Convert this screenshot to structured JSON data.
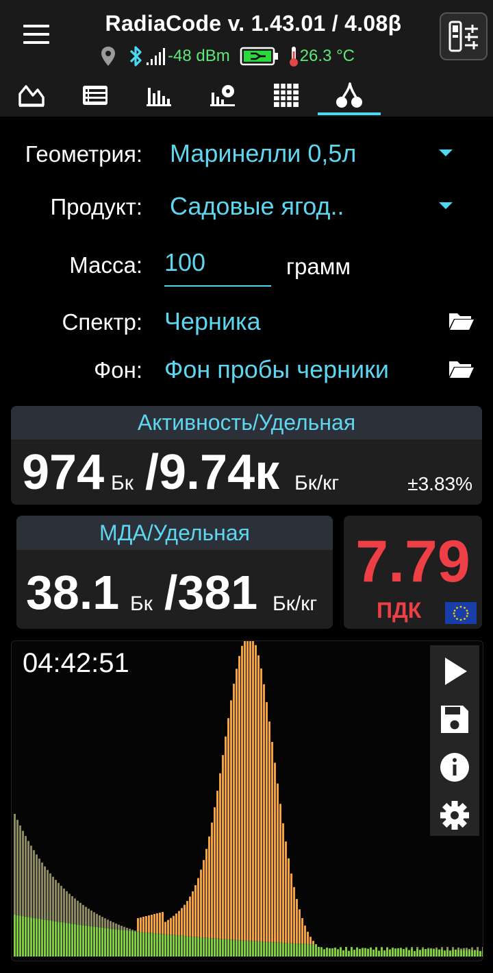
{
  "header": {
    "title": "RadiaCode v. 1.43.01 / 4.08β",
    "signal": "-48 dBm",
    "temperature": "26.3 °C"
  },
  "tabs": [
    {
      "icon": "area-chart-icon",
      "active": false
    },
    {
      "icon": "table-icon",
      "active": false
    },
    {
      "icon": "bar-chart-icon",
      "active": false
    },
    {
      "icon": "dose-chart-icon",
      "active": false
    },
    {
      "icon": "grid-icon",
      "active": false
    },
    {
      "icon": "cherry-icon",
      "active": true
    }
  ],
  "form": {
    "geometry_label": "Геометрия:",
    "geometry_value": "Маринелли 0,5л",
    "product_label": "Продукт:",
    "product_value": "Садовые ягод..",
    "mass_label": "Масса:",
    "mass_value": "100",
    "mass_unit": "грамм",
    "spectrum_label": "Спектр:",
    "spectrum_value": "Черника",
    "background_label": "Фон:",
    "background_value": "Фон пробы черники"
  },
  "activity": {
    "header": "Активность/Удельная",
    "value": "974",
    "unit": "Бк",
    "specific": "/9.74к",
    "specific_unit": "Бк/кг",
    "error": "±3.83%"
  },
  "mda": {
    "header": "МДА/Удельная",
    "value": "38.1",
    "unit": "Бк",
    "specific": "/381",
    "specific_unit": "Бк/кг"
  },
  "limit": {
    "value": "7.79",
    "label": "ПДК"
  },
  "spectrum": {
    "timer": "04:42:51",
    "colors": {
      "background": "#8a8a5e",
      "sample": "#f5a33a",
      "overlap": "#7fd13a"
    }
  }
}
